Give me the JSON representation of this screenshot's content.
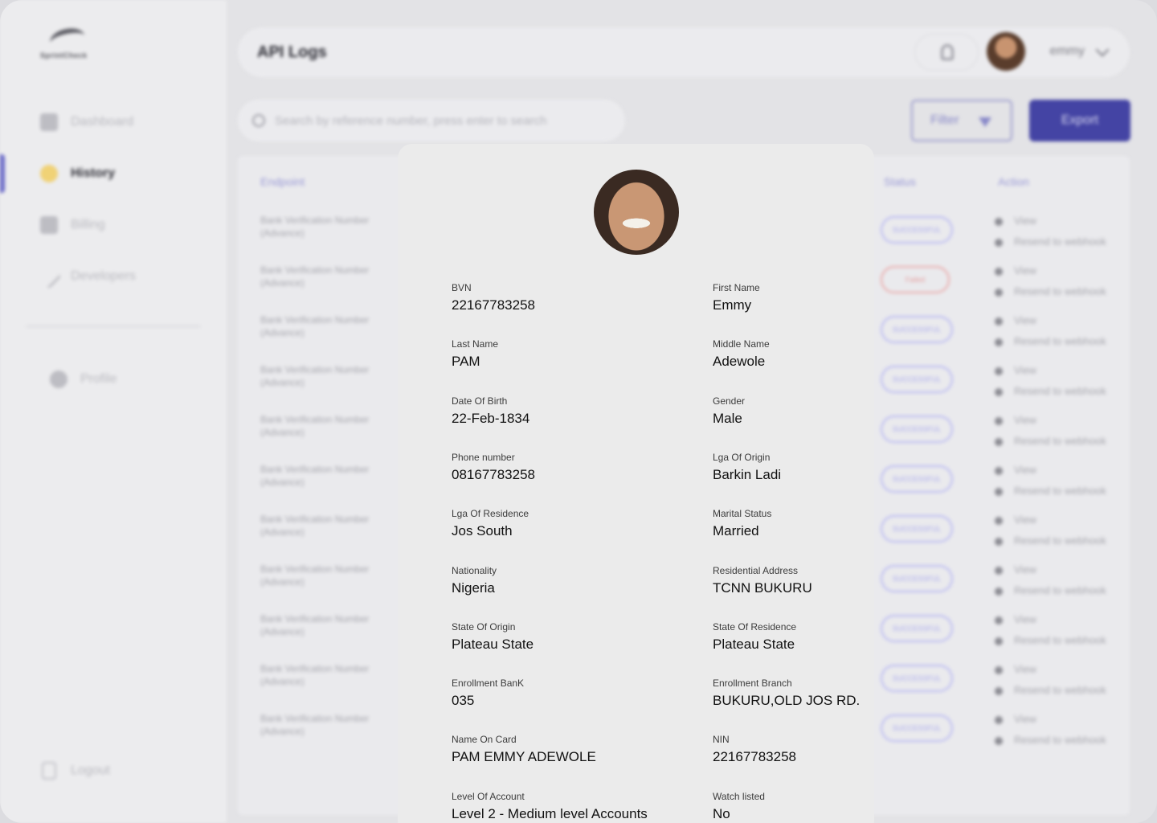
{
  "app": {
    "brand": "SprintCheck",
    "page_title": "API Logs",
    "user": "emmy"
  },
  "sidebar": {
    "items": [
      {
        "label": "Dashboard",
        "icon": "grid-icon"
      },
      {
        "label": "History",
        "icon": "history-icon"
      },
      {
        "label": "Billing",
        "icon": "billing-icon"
      },
      {
        "label": "Developers",
        "icon": "pen-icon"
      }
    ],
    "profile": "Profile",
    "logout": "Logout"
  },
  "toolbar": {
    "search_placeholder": "Search by reference number, press enter to search",
    "filter": "Filter",
    "export": "Export"
  },
  "table": {
    "headers": [
      "Endpoint",
      "Status",
      "Action"
    ],
    "rows": [
      {
        "endpoint": "Bank Verification Number (Advance)",
        "status": "SUCCESSFUL"
      },
      {
        "endpoint": "Bank Verification Number (Advance)",
        "status": "Failed"
      },
      {
        "endpoint": "Bank Verification Number (Advance)",
        "status": "SUCCESSFUL"
      },
      {
        "endpoint": "Bank Verification Number (Advance)",
        "status": "SUCCESSFUL"
      },
      {
        "endpoint": "Bank Verification Number (Advance)",
        "status": "SUCCESSFUL"
      },
      {
        "endpoint": "Bank Verification Number (Advance)",
        "status": "SUCCESSFUL"
      },
      {
        "endpoint": "Bank Verification Number (Advance)",
        "status": "SUCCESSFUL"
      },
      {
        "endpoint": "Bank Verification Number (Advance)",
        "status": "SUCCESSFUL"
      },
      {
        "endpoint": "Bank Verification Number (Advance)",
        "status": "SUCCESSFUL"
      },
      {
        "endpoint": "Bank Verification Number (Advance)",
        "status": "SUCCESSFUL"
      },
      {
        "endpoint": "Bank Verification Number (Advance)",
        "status": "SUCCESSFUL"
      }
    ],
    "action_view": "View",
    "action_resend": "Resend to webhook"
  },
  "details": {
    "fields": [
      {
        "label": "BVN",
        "value": "22167783258"
      },
      {
        "label": "First Name",
        "value": "Emmy"
      },
      {
        "label": "Last Name",
        "value": "PAM"
      },
      {
        "label": "Middle Name",
        "value": "Adewole"
      },
      {
        "label": "Date Of Birth",
        "value": "22-Feb-1834"
      },
      {
        "label": "Gender",
        "value": "Male"
      },
      {
        "label": "Phone number",
        "value": "08167783258"
      },
      {
        "label": "Lga Of Origin",
        "value": "Barkin Ladi"
      },
      {
        "label": "Lga Of Residence",
        "value": "Jos South"
      },
      {
        "label": "Marital Status",
        "value": "Married"
      },
      {
        "label": "Nationality",
        "value": "Nigeria"
      },
      {
        "label": "Residential Address",
        "value": "TCNN BUKURU"
      },
      {
        "label": "State Of Origin",
        "value": "Plateau State"
      },
      {
        "label": "State Of Residence",
        "value": "Plateau State"
      },
      {
        "label": "Enrollment BanK",
        "value": "035"
      },
      {
        "label": "Enrollment Branch",
        "value": "BUKURU,OLD JOS RD."
      },
      {
        "label": "Name On Card",
        "value": "PAM EMMY  ADEWOLE"
      },
      {
        "label": "NIN",
        "value": "22167783258"
      },
      {
        "label": "Level Of Account",
        "value": "Level 2 - Medium level Accounts"
      },
      {
        "label": "Watch listed",
        "value": "No"
      }
    ]
  }
}
